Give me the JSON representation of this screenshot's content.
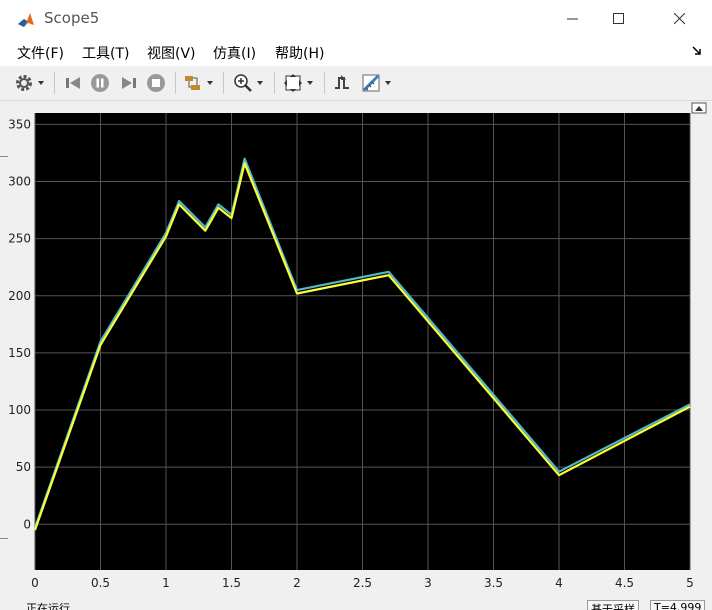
{
  "window": {
    "title": "Scope5",
    "icon": "matlab-logo-icon"
  },
  "menu": [
    "文件(F)",
    "工具(T)",
    "视图(V)",
    "仿真(I)",
    "帮助(H)"
  ],
  "toolbar": {
    "icons": [
      "gear-icon",
      "step-back-icon",
      "pause-icon",
      "step-forward-icon",
      "stop-icon",
      "highlight-block-icon",
      "zoom-in-icon",
      "autoscale-icon",
      "triggers-icon",
      "cursor-measurements-icon"
    ]
  },
  "status": {
    "left": "正在运行",
    "mid": "基于采样",
    "right": "T=4.999"
  },
  "chart_data": {
    "type": "line",
    "xlim": [
      0,
      5
    ],
    "ylim": [
      -40,
      360
    ],
    "xticks": [
      "0",
      "0.5",
      "1",
      "1.5",
      "2",
      "2.5",
      "3",
      "3.5",
      "4",
      "4.5",
      "5"
    ],
    "yticks": [
      "0",
      "50",
      "100",
      "150",
      "200",
      "250",
      "300",
      "350"
    ],
    "grid": true,
    "colors": {
      "background": "#000000",
      "grid": "#555555",
      "series1": "#4fb8c9",
      "series2": "#ffff33"
    },
    "series": [
      {
        "x": [
          0,
          0.5,
          1.0,
          1.1,
          1.3,
          1.4,
          1.5,
          1.6,
          2.0,
          2.7,
          4.0,
          5.0
        ],
        "values": [
          -3,
          160,
          255,
          283,
          260,
          280,
          271,
          320,
          205,
          221,
          46,
          105
        ]
      },
      {
        "x": [
          0,
          0.5,
          1.0,
          1.1,
          1.3,
          1.4,
          1.5,
          1.6,
          2.0,
          2.7,
          4.0,
          5.0
        ],
        "values": [
          -5,
          157,
          252,
          280,
          257,
          277,
          268,
          316,
          202,
          218,
          43,
          103
        ]
      }
    ]
  }
}
